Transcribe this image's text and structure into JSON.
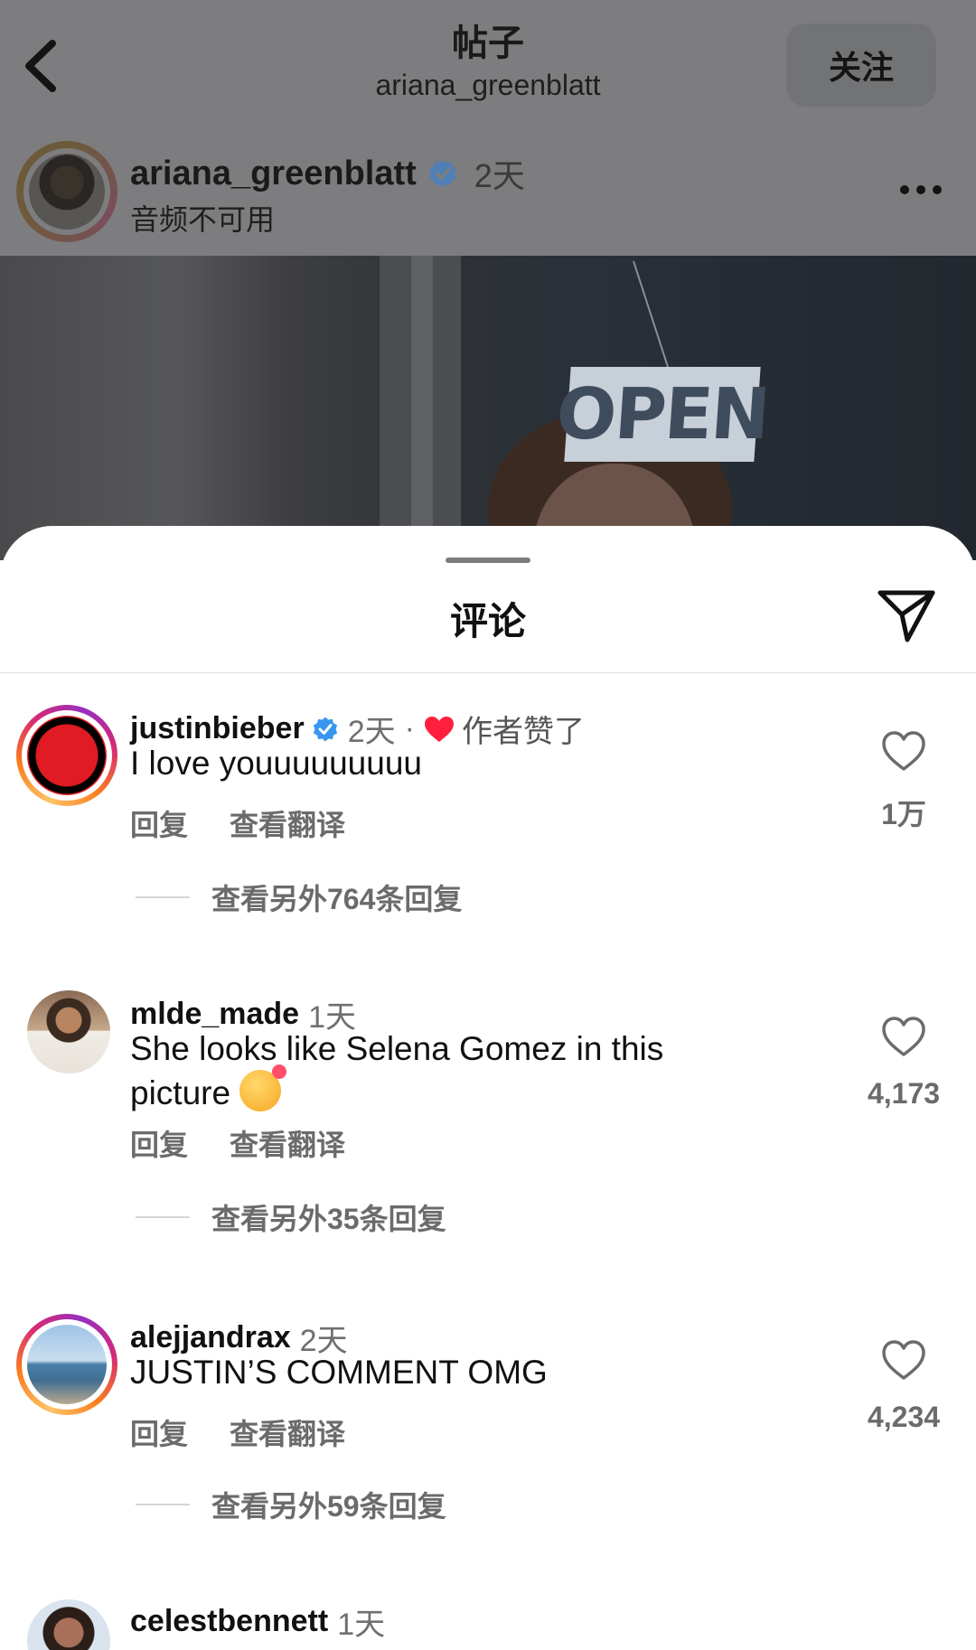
{
  "header": {
    "title": "帖子",
    "subtitle": "ariana_greenblatt",
    "follow_label": "关注"
  },
  "post": {
    "author": "ariana_greenblatt",
    "time": "2天",
    "audio_status": "音频不可用",
    "image_sign_text": "OPEN"
  },
  "comments_sheet": {
    "title": "评论",
    "comments": [
      {
        "user": "justinbieber",
        "verified": true,
        "time": "2天",
        "separator": "·",
        "liked_by_author": "作者赞了",
        "text": "I love youuuuuuuuu",
        "reply_label": "回复",
        "translate_label": "查看翻译",
        "more_replies": "查看另外764条回复",
        "likes": "1万"
      },
      {
        "user": "mlde_made",
        "time": "1天",
        "text": "She looks like Selena Gomez in this picture",
        "emoji": "smiling-face-with-hearts",
        "reply_label": "回复",
        "translate_label": "查看翻译",
        "more_replies": "查看另外35条回复",
        "likes": "4,173"
      },
      {
        "user": "alejjandrax",
        "time": "2天",
        "text": "JUSTIN’S COMMENT OMG",
        "reply_label": "回复",
        "translate_label": "查看翻译",
        "more_replies": "查看另外59条回复",
        "likes": "4,234"
      },
      {
        "user": "celestbennett",
        "time": "1天"
      }
    ]
  },
  "colors": {
    "liked_heart": "#ff1f3d",
    "verified_badge": "#3797f0",
    "dim_overlay": "#7d7d7f"
  }
}
